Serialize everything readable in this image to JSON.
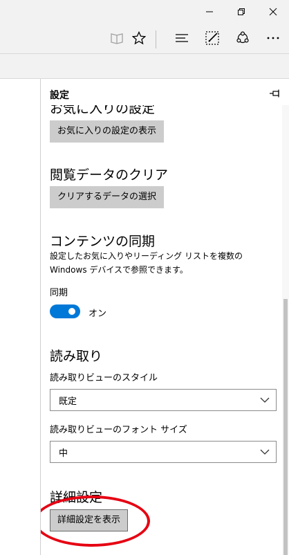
{
  "panel": {
    "title": "設定",
    "sections": {
      "favorites": {
        "heading_partial": "お気に入りの設定",
        "button": "お気に入りの設定の表示"
      },
      "clear": {
        "heading": "閲覧データのクリア",
        "button": "クリアするデータの選択"
      },
      "sync": {
        "heading": "コンテンツの同期",
        "description": "設定したお気に入りやリーディング リストを複数の Windows デバイスで参照できます。",
        "label": "同期",
        "toggle_state": "オン"
      },
      "reading": {
        "heading": "読み取り",
        "style_label": "読み取りビューのスタイル",
        "style_value": "既定",
        "font_label": "読み取りビューのフォント サイズ",
        "font_value": "中"
      },
      "advanced": {
        "heading": "詳細設定",
        "button": "詳細設定を表示"
      }
    }
  },
  "colors": {
    "accent": "#0078d7",
    "highlight": "#e60012",
    "chrome": "#f2f2f2"
  }
}
